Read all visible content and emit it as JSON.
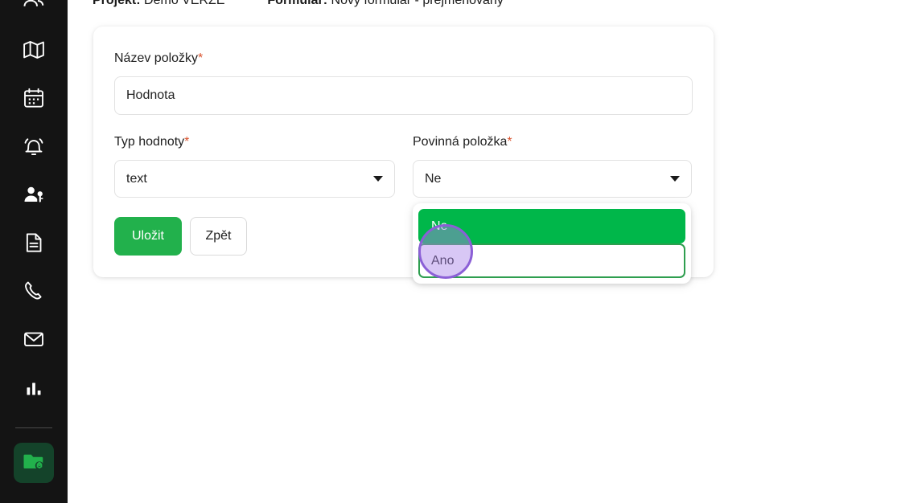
{
  "sidebar": {
    "items": [
      {
        "icon": "users-icon",
        "name": "sidebar-item-users"
      },
      {
        "icon": "map-icon",
        "name": "sidebar-item-map"
      },
      {
        "icon": "calendar-icon",
        "name": "sidebar-item-calendar"
      },
      {
        "icon": "bell-icon",
        "name": "sidebar-item-notifications"
      },
      {
        "icon": "user-key-icon",
        "name": "sidebar-item-permissions"
      },
      {
        "icon": "document-icon",
        "name": "sidebar-item-documents"
      },
      {
        "icon": "phone-icon",
        "name": "sidebar-item-calls"
      },
      {
        "icon": "mail-icon",
        "name": "sidebar-item-mail"
      },
      {
        "icon": "bar-chart-icon",
        "name": "sidebar-item-statistics"
      }
    ],
    "active": {
      "icon": "folder-settings-icon",
      "name": "sidebar-item-project-settings"
    },
    "background": "#141414",
    "active_background": "#14432a",
    "active_accent": "#22b14c"
  },
  "header": {
    "project_label": "Projekt:",
    "project_value": "Demo VERZE",
    "form_label": "Formulář:",
    "form_value": "Nový formulář - přejmenovaný"
  },
  "form": {
    "name_field": {
      "label": "Název položky",
      "required_mark": "*",
      "value": "Hodnota",
      "placeholder": "Hodnota"
    },
    "type_field": {
      "label": "Typ hodnoty",
      "required_mark": "*",
      "value": "text",
      "caret": "chevron-down-icon"
    },
    "required_field": {
      "label": "Povinná položka",
      "required_mark": "*",
      "value": "Ne",
      "caret": "chevron-down-icon",
      "options": [
        {
          "label": "Ne",
          "state": "selected"
        },
        {
          "label": "Ano",
          "state": "highlighted"
        }
      ]
    },
    "buttons": {
      "save": "Uložit",
      "back": "Zpět"
    }
  },
  "colors": {
    "primary_green": "#22b14c",
    "dropdown_green": "#00b74a",
    "option_border_green": "#2e9e4f",
    "required_asterisk": "#d9512c",
    "cursor_purple": "#8b5fd6",
    "card_background": "#ffffff",
    "page_background": "#ffffff"
  }
}
